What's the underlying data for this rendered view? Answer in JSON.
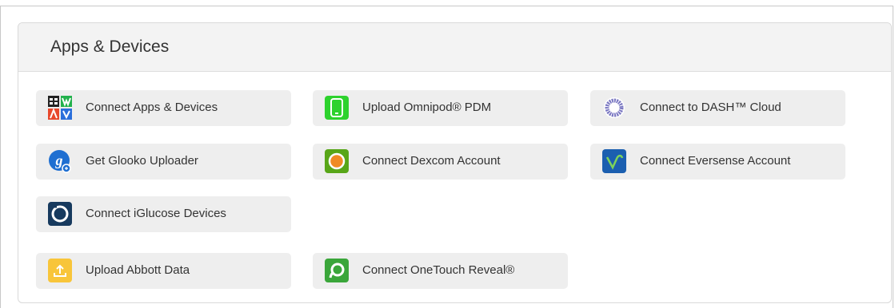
{
  "panel": {
    "title": "Apps & Devices"
  },
  "buttons": {
    "connect_apps": {
      "label": "Connect Apps & Devices",
      "icon": "apps-grid-icon"
    },
    "omnipod_pdm": {
      "label": "Upload Omnipod® PDM",
      "icon": "phone-icon",
      "color": "#2dd22d"
    },
    "dash_cloud": {
      "label": "Connect to DASH™ Cloud",
      "icon": "ring-icon"
    },
    "glooko_uploader": {
      "label": "Get Glooko Uploader",
      "icon": "glooko-logo-icon",
      "color": "#1f6fd1"
    },
    "dexcom": {
      "label": "Connect Dexcom Account",
      "icon": "dexcom-logo-icon",
      "color": "#58a618"
    },
    "eversense": {
      "label": "Connect Eversense Account",
      "icon": "eversense-logo-icon",
      "color": "#1b5fb0"
    },
    "iglucose": {
      "label": "Connect iGlucose Devices",
      "icon": "iglucose-logo-icon"
    },
    "abbott": {
      "label": "Upload Abbott Data",
      "icon": "upload-icon",
      "color": "#f8c53a"
    },
    "onetouch": {
      "label": "Connect OneTouch Reveal®",
      "icon": "onetouch-logo-icon",
      "color": "#3aa63a"
    }
  }
}
